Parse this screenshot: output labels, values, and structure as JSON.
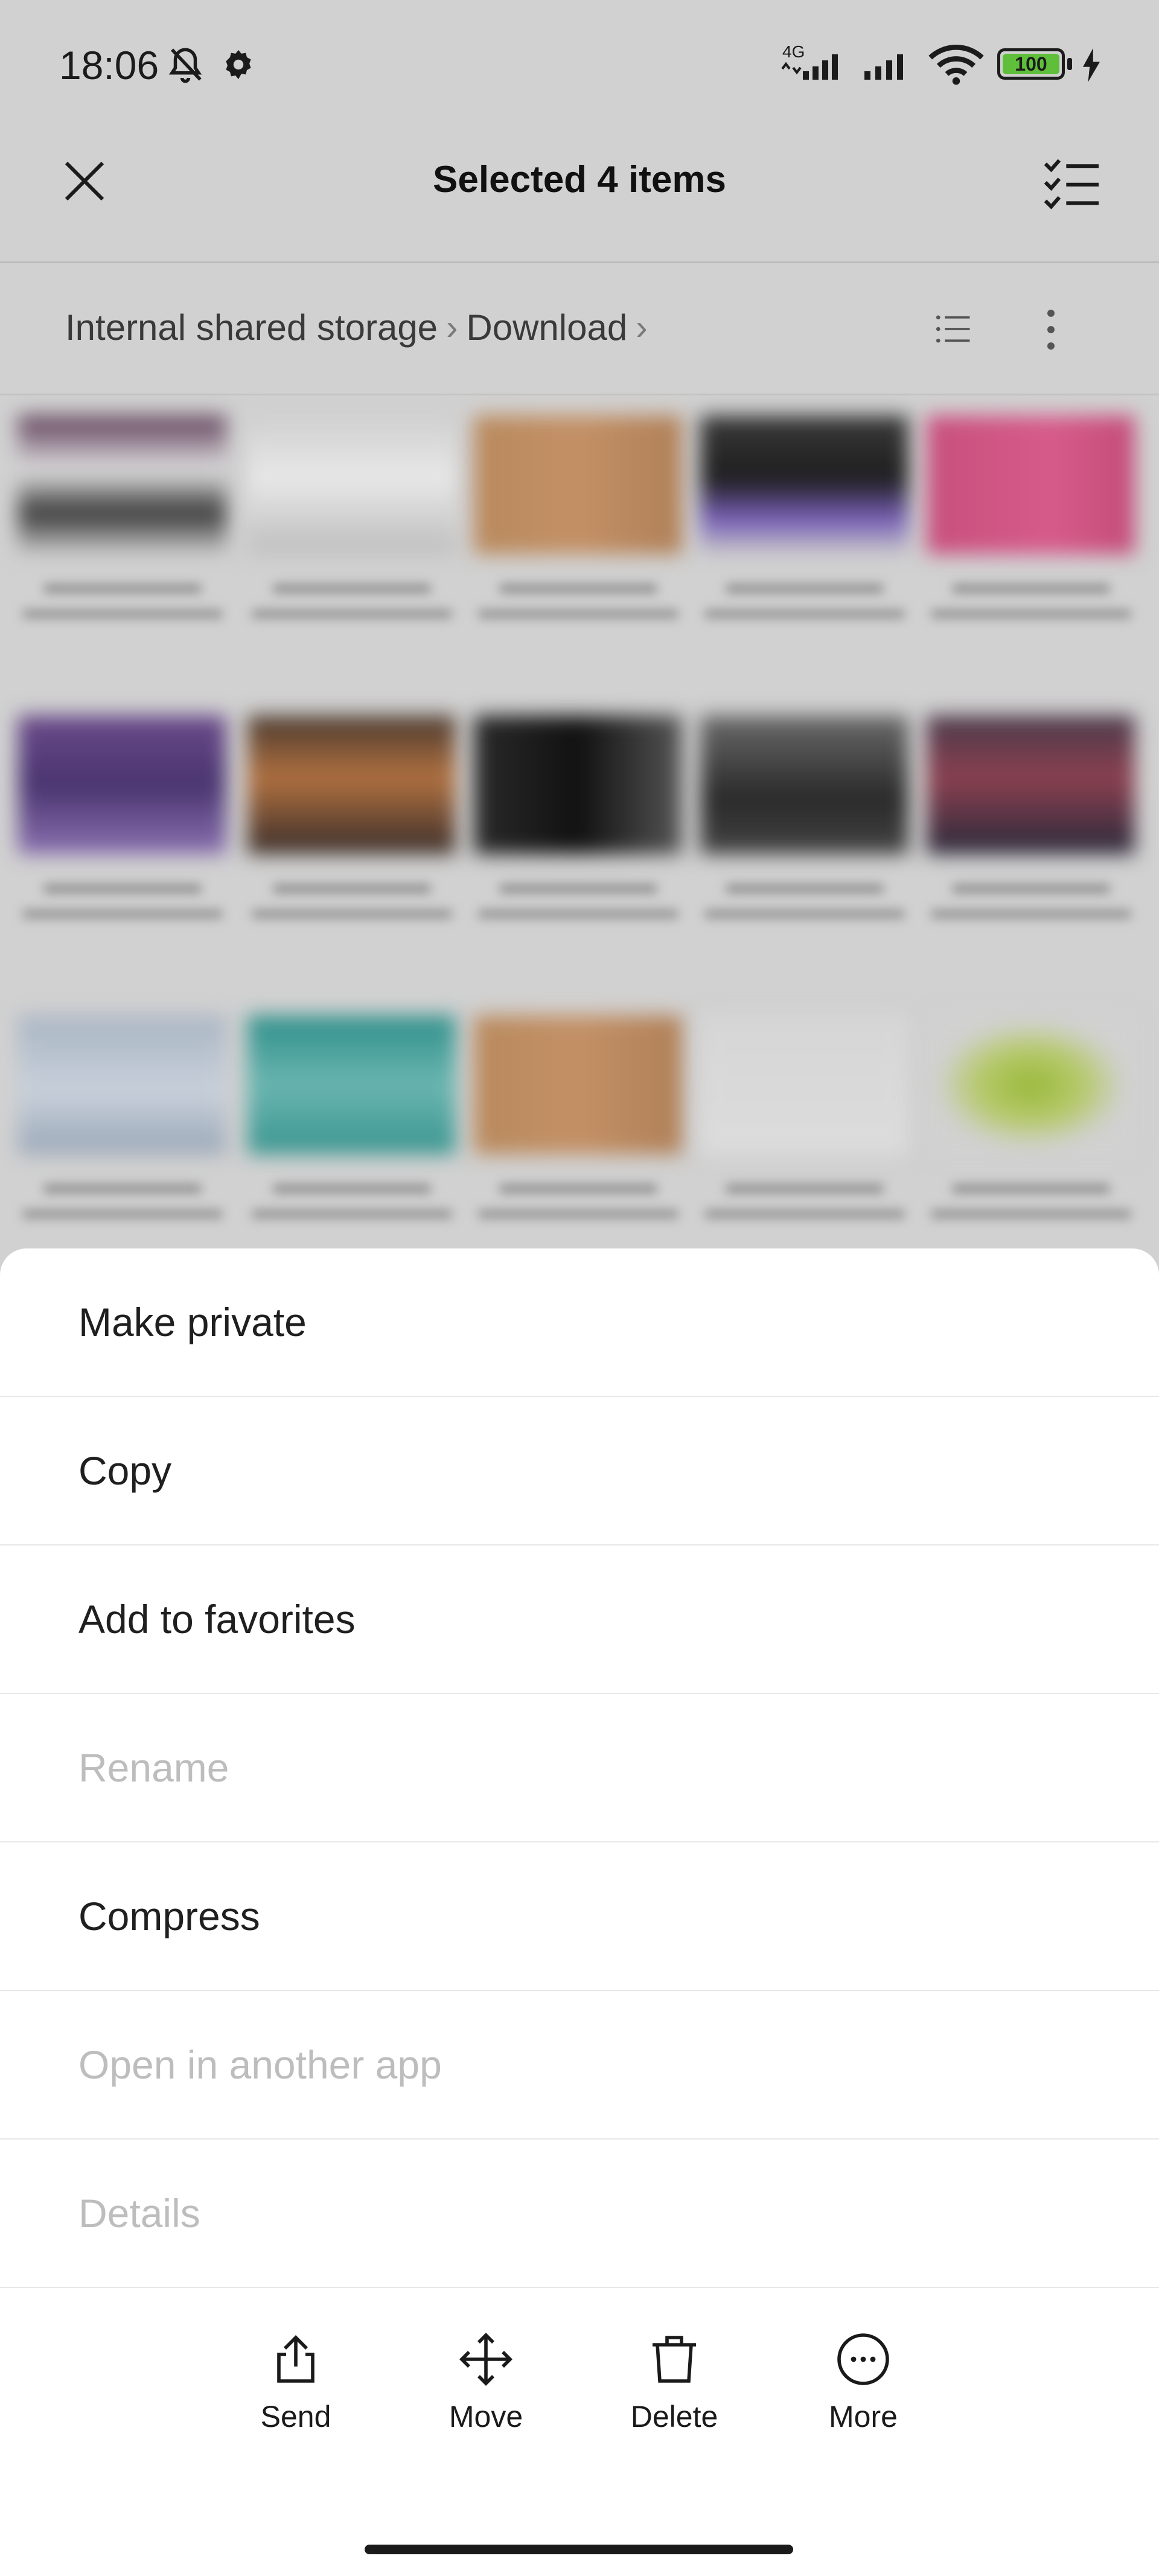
{
  "status_bar": {
    "time": "18:06",
    "network_label": "4G",
    "battery_level": "100"
  },
  "toolbar": {
    "title": "Selected 4 items"
  },
  "breadcrumb": {
    "items": [
      "Internal shared storage",
      "Download"
    ]
  },
  "menu": {
    "items": [
      {
        "label": "Make private",
        "enabled": true
      },
      {
        "label": "Copy",
        "enabled": true
      },
      {
        "label": "Add to favorites",
        "enabled": true
      },
      {
        "label": "Rename",
        "enabled": false
      },
      {
        "label": "Compress",
        "enabled": true
      },
      {
        "label": "Open in another app",
        "enabled": false
      },
      {
        "label": "Details",
        "enabled": false
      }
    ]
  },
  "actions": {
    "send": "Send",
    "move": "Move",
    "delete": "Delete",
    "more": "More"
  },
  "colors": {
    "overlay": "#d1d1d1",
    "sheet": "#ffffff",
    "disabled_text": "#bdbdbd",
    "battery": "#5fbf3a"
  },
  "icons": [
    "close-icon",
    "select-all-icon",
    "list-view-icon",
    "more-vert-icon",
    "send-icon",
    "move-icon",
    "delete-icon",
    "more-icon",
    "mute-icon",
    "settings-icon",
    "signal-icon",
    "wifi-icon",
    "battery-icon",
    "charging-icon"
  ]
}
